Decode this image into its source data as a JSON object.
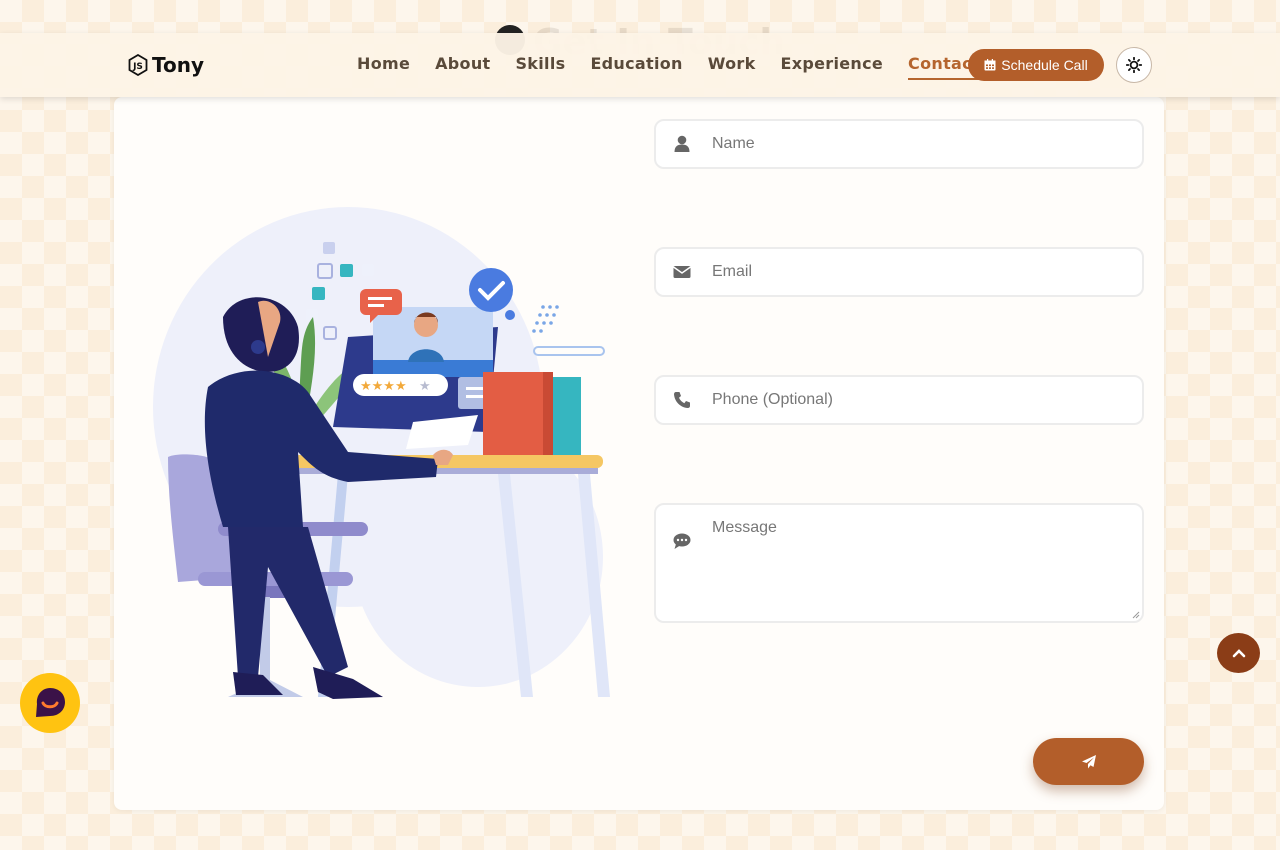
{
  "background_heading": "Get In Touch",
  "navbar": {
    "brand": "Tony",
    "links": [
      "Home",
      "About",
      "Skills",
      "Education",
      "Work",
      "Experience",
      "Contact"
    ],
    "active_link": "Contact",
    "schedule_label": "Schedule Call"
  },
  "form": {
    "name_placeholder": "Name",
    "email_placeholder": "Email",
    "phone_placeholder": "Phone (Optional)",
    "message_placeholder": "Message"
  },
  "colors": {
    "accent": "#b35e2a",
    "page_bg": "#fdf6ec",
    "scroll_top": "#8b3d17",
    "chat_widget": "#ffc311"
  },
  "icons": {
    "brand": "nodejs-logo-icon",
    "schedule": "calendar-icon",
    "theme": "sun-icon",
    "name": "user-icon",
    "email": "envelope-icon",
    "phone": "phone-icon",
    "message": "comments-icon",
    "send": "paper-plane-icon",
    "scroll_top": "chevron-up-icon",
    "chat": "chat-icon"
  }
}
